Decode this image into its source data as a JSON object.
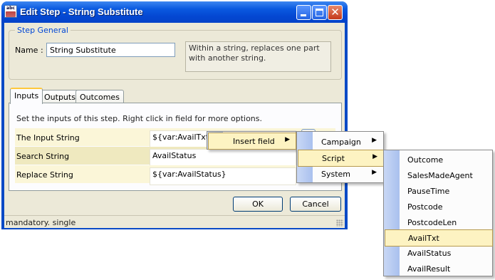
{
  "window": {
    "title": "Edit Step - String Substitute",
    "icon": "string-substitute-app-icon",
    "min_icon": "minimize-icon",
    "max_icon": "maximize-icon",
    "close_icon": "close-icon"
  },
  "step_general": {
    "legend": "Step General",
    "name_label": "Name :",
    "name_value": "String Substitute",
    "description": "Within a string, replaces one part with another string."
  },
  "tabs": [
    {
      "label": "Inputs",
      "selected": true
    },
    {
      "label": "Outputs",
      "selected": false
    },
    {
      "label": "Outcomes",
      "selected": false
    }
  ],
  "inputs": {
    "hint": "Set the inputs of this step.  Right click in field for more options.",
    "rows": [
      {
        "label": "The Input String",
        "value": "${var:AvailTxt}"
      },
      {
        "label": "Search String",
        "value": "AvailStatus"
      },
      {
        "label": "Replace String",
        "value": "${var:AvailStatus}"
      }
    ]
  },
  "buttons": {
    "ok": "OK",
    "cancel": "Cancel"
  },
  "status": "mandatory. single",
  "context_menu": {
    "level1": [
      {
        "label": "Insert field",
        "has_submenu": true,
        "highlighted": true
      }
    ],
    "level2": [
      {
        "label": "Campaign",
        "has_submenu": true,
        "highlighted": false
      },
      {
        "label": "Script",
        "has_submenu": true,
        "highlighted": true
      },
      {
        "label": "System",
        "has_submenu": true,
        "highlighted": false
      }
    ],
    "level3": [
      {
        "label": "Outcome",
        "highlighted": false
      },
      {
        "label": "SalesMadeAgent",
        "highlighted": false
      },
      {
        "label": "PauseTime",
        "highlighted": false
      },
      {
        "label": "Postcode",
        "highlighted": false
      },
      {
        "label": "PostcodeLen",
        "highlighted": false
      },
      {
        "label": "AvailTxt",
        "highlighted": true
      },
      {
        "label": "AvailStatus",
        "highlighted": false
      },
      {
        "label": "AvailResult",
        "highlighted": false
      }
    ]
  },
  "colors": {
    "titlebar": "#0a5ae0",
    "legend_text": "#0046d5",
    "menu_highlight": "#fdf3c2",
    "dialog_face": "#ece9d8"
  }
}
